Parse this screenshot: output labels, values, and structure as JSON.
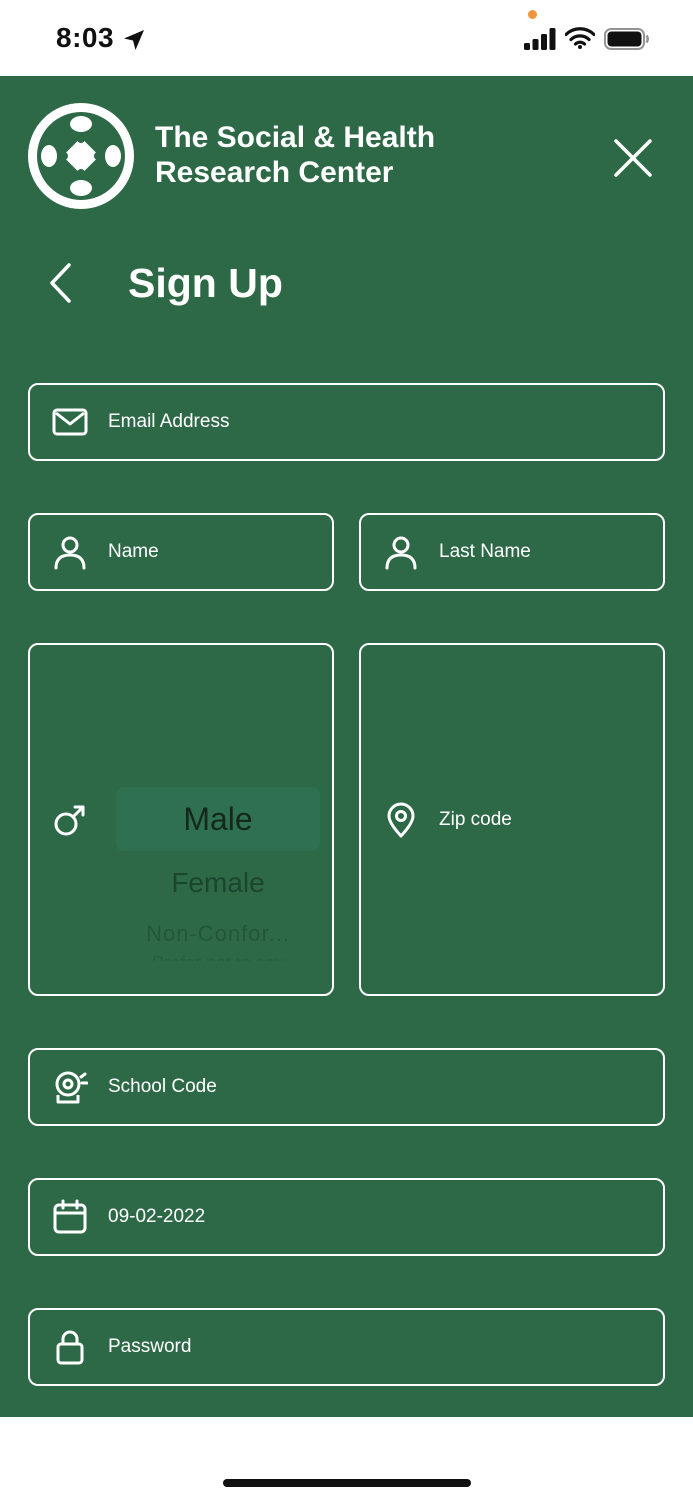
{
  "status_bar": {
    "time": "8:03"
  },
  "header": {
    "brand_line1": "The Social & Health",
    "brand_line2": "Research Center"
  },
  "page": {
    "title": "Sign Up"
  },
  "form": {
    "email": {
      "placeholder": "Email Address",
      "icon": "envelope-icon"
    },
    "first_name": {
      "placeholder": "Name",
      "icon": "person-icon"
    },
    "last_name": {
      "placeholder": "Last Name",
      "icon": "person-icon"
    },
    "gender": {
      "icon": "male-symbol-icon",
      "selected": "Male",
      "options": [
        "Male",
        "Female",
        "Non-Confor...",
        "Prefer not to say"
      ]
    },
    "zip": {
      "placeholder": "Zip code",
      "icon": "location-pin-icon"
    },
    "school_code": {
      "placeholder": "School Code",
      "icon": "school-bell-icon"
    },
    "birth_date": {
      "value": "09-02-2022",
      "icon": "calendar-icon"
    },
    "password": {
      "placeholder": "Password",
      "icon": "lock-icon"
    }
  },
  "colors": {
    "background": "#2d6947",
    "foreground": "#ffffff",
    "picker_highlight": "#2f7050",
    "status_dot": "#f0953a"
  }
}
